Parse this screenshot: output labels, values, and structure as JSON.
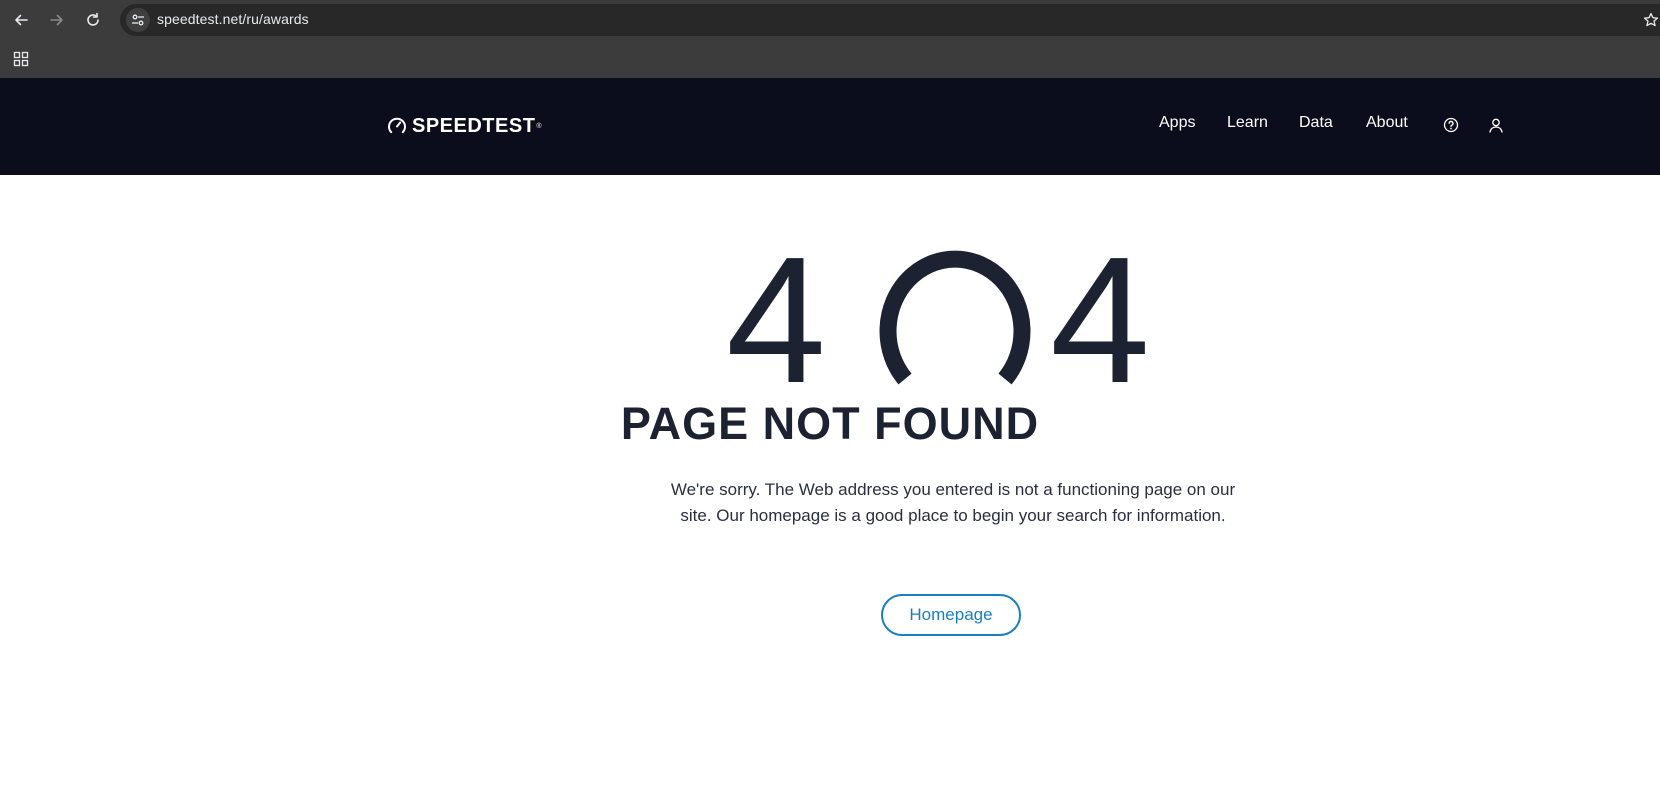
{
  "browser": {
    "url": "speedtest.net/ru/awards",
    "icons": [
      "back-icon",
      "forward-icon",
      "reload-icon",
      "site-info-icon",
      "bookmark-star-icon",
      "apps-grid-icon"
    ]
  },
  "header": {
    "logo_text": "SPEEDTEST",
    "logo_tm": "®",
    "nav": [
      "Apps",
      "Learn",
      "Data",
      "About"
    ],
    "icons": [
      "help-icon",
      "account-icon"
    ]
  },
  "main": {
    "code_left": "4",
    "code_right": "4",
    "headline": "PAGE NOT FOUND",
    "message": "We're sorry. The Web address you entered is not a functioning page on our site. Our homepage is a good place to begin your search for information.",
    "button_label": "Homepage"
  },
  "colors": {
    "header_bg": "#0b0d1c",
    "text_dark": "#1d2233",
    "accent": "#1a7ec2"
  }
}
